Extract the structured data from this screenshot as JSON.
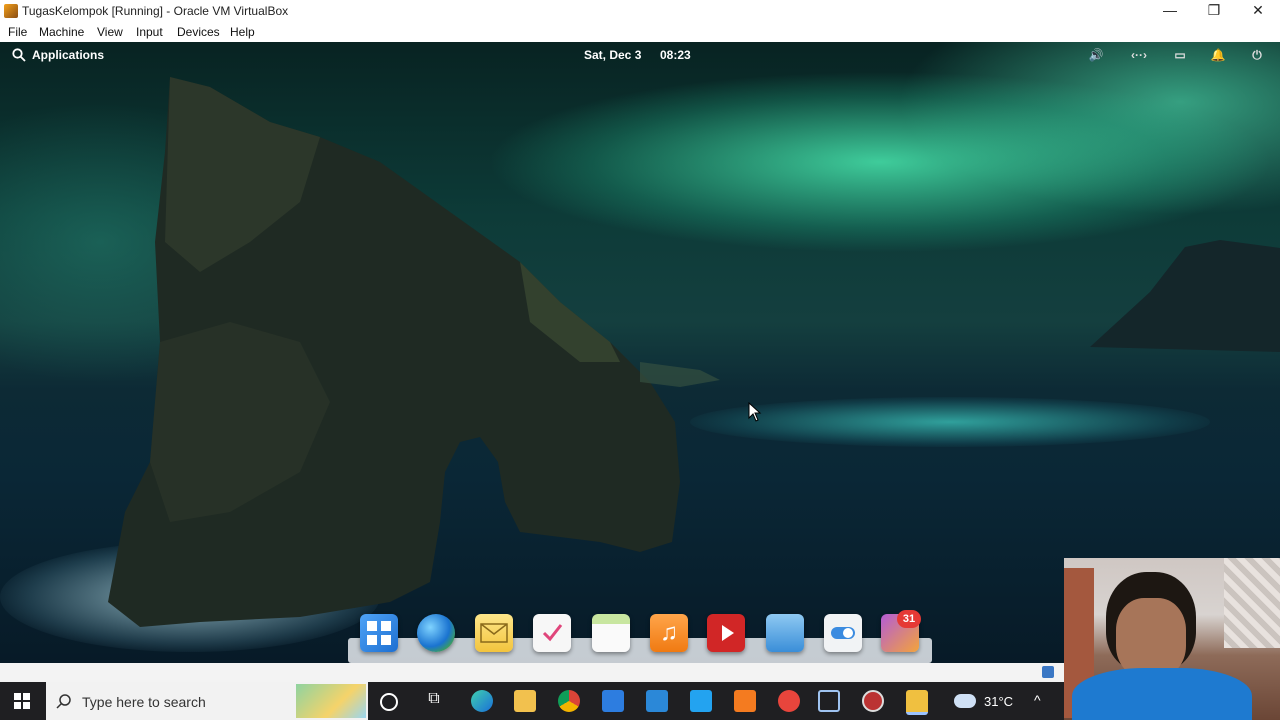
{
  "window": {
    "title": "TugasKelompok [Running] - Oracle VM VirtualBox",
    "controls": {
      "minimize": "—",
      "restore": "❐",
      "close": "✕"
    }
  },
  "menubar": [
    "File",
    "Machine",
    "View",
    "Input",
    "Devices",
    "Help"
  ],
  "guest": {
    "topbar": {
      "applications_label": "Applications",
      "date": "Sat, Dec  3",
      "time": "08:23"
    },
    "dock": {
      "items": [
        "workspace-switcher",
        "web-browser",
        "mail",
        "tasks",
        "calendar",
        "music",
        "videos",
        "photos",
        "settings",
        "app-center"
      ],
      "app_center_badge": "31"
    }
  },
  "taskbar": {
    "search_placeholder": "Type here to search",
    "weather_temp": "31°C",
    "pinned": [
      "cortana",
      "task-view",
      "edge",
      "file-explorer",
      "chrome",
      "store",
      "mail",
      "vscode",
      "xampp",
      "app-red",
      "virtualbox",
      "app-circle",
      "app-yellow"
    ]
  },
  "colors": {
    "aurora": "#50ffbe",
    "sea": "#0a2736",
    "taskbar": "#1f1f22",
    "badge": "#e53935"
  }
}
